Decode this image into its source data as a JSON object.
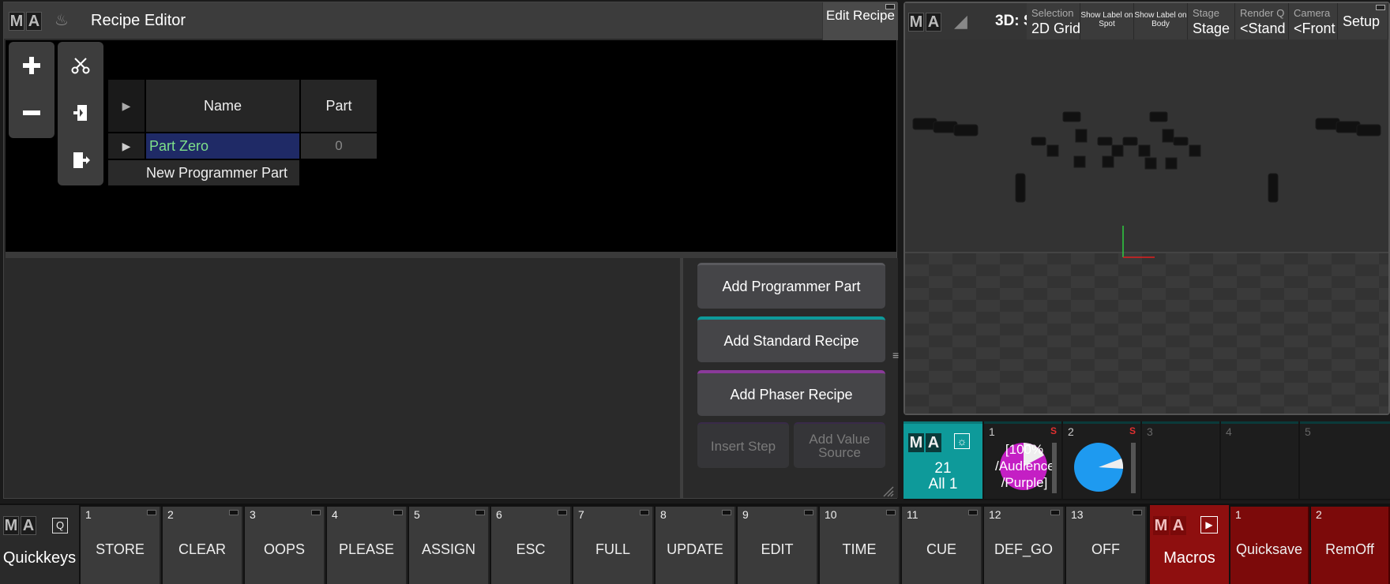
{
  "recipe_editor": {
    "title": "Recipe Editor",
    "edit_recipe_label": "Edit Recipe",
    "grid": {
      "headers": {
        "name": "Name",
        "part": "Part"
      },
      "rows": [
        {
          "name": "Part Zero",
          "part": "0"
        }
      ],
      "new_row_label": "New Programmer Part"
    },
    "actions": {
      "add_programmer_part": "Add Programmer Part",
      "add_standard_recipe": "Add Standard Recipe",
      "add_phaser_recipe": "Add Phaser Recipe",
      "insert_step": "Insert Step",
      "add_value_source": "Add Value Source"
    }
  },
  "viewer_3d": {
    "title": "3D: S",
    "toolbar": [
      {
        "small": "Selection",
        "big": "2D Grid"
      },
      {
        "tiny": "Show Label on Spot"
      },
      {
        "tiny": "Show Label on Body"
      },
      {
        "small": "Stage",
        "big": "Stage"
      },
      {
        "small": "Render Q",
        "big": "<Stand"
      },
      {
        "small": "Camera",
        "big": "<Front"
      },
      {
        "big": "Setup"
      }
    ]
  },
  "executors": {
    "master": {
      "line1": "21",
      "line2": "All 1"
    },
    "items": [
      {
        "num": "1",
        "text": "[100% /Audience /Purple]",
        "flag": "S"
      },
      {
        "num": "2",
        "text": "",
        "flag": "S"
      },
      {
        "num": "3",
        "text": ""
      },
      {
        "num": "4",
        "text": ""
      },
      {
        "num": "5",
        "text": ""
      }
    ]
  },
  "quickkeys": {
    "title": "Quickkeys",
    "keys": [
      {
        "num": "1",
        "label": "STORE"
      },
      {
        "num": "2",
        "label": "CLEAR"
      },
      {
        "num": "3",
        "label": "OOPS"
      },
      {
        "num": "4",
        "label": "PLEASE"
      },
      {
        "num": "5",
        "label": "ASSIGN"
      },
      {
        "num": "6",
        "label": "ESC"
      },
      {
        "num": "7",
        "label": "FULL"
      },
      {
        "num": "8",
        "label": "UPDATE"
      },
      {
        "num": "9",
        "label": "EDIT"
      },
      {
        "num": "10",
        "label": "TIME"
      },
      {
        "num": "11",
        "label": "CUE"
      },
      {
        "num": "12",
        "label": "DEF_GO"
      },
      {
        "num": "13",
        "label": "OFF"
      }
    ]
  },
  "macros": {
    "title": "Macros",
    "keys": [
      {
        "num": "1",
        "label": "Quicksave"
      },
      {
        "num": "2",
        "label": "RemOff"
      }
    ]
  },
  "colors": {
    "accent_teal": "#0e9a9a",
    "macro_red": "#8e0f0f",
    "selection_blue": "#1f2a66",
    "part_name_green": "#7ee08a",
    "executor_magenta": "#c41fc4",
    "executor_blue": "#1e9af0"
  }
}
